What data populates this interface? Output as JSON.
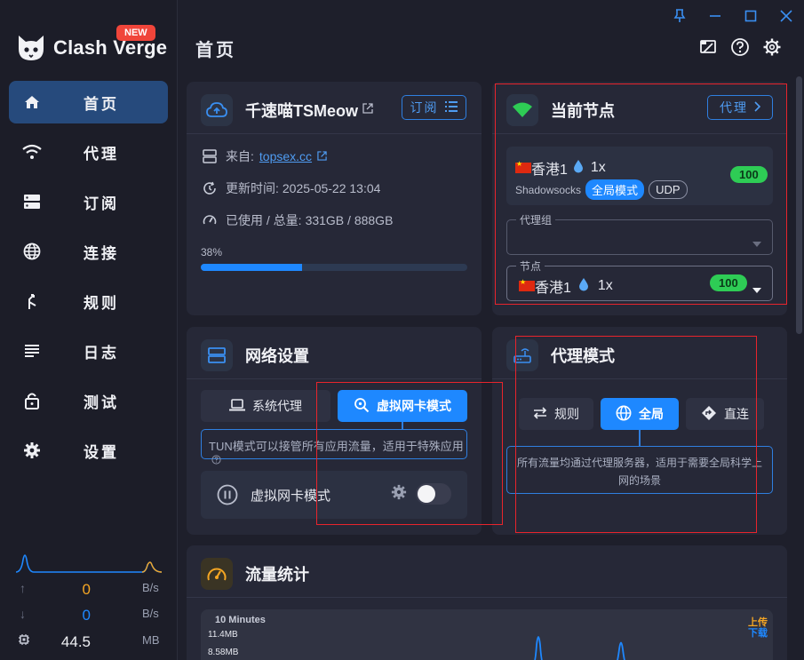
{
  "app": {
    "name": "Clash Verge",
    "badge": "NEW"
  },
  "page_title": "首页",
  "sidebar": {
    "items": [
      {
        "label": "首页",
        "icon": "home-icon",
        "active": true
      },
      {
        "label": "代理",
        "icon": "wifi-icon"
      },
      {
        "label": "订阅",
        "icon": "storage-icon"
      },
      {
        "label": "连接",
        "icon": "globe-icon"
      },
      {
        "label": "规则",
        "icon": "fork-icon"
      },
      {
        "label": "日志",
        "icon": "list-icon"
      },
      {
        "label": "测试",
        "icon": "lock-icon"
      },
      {
        "label": "设置",
        "icon": "gear-icon"
      }
    ],
    "traffic": {
      "upload": "0",
      "upload_unit": "B/s",
      "download": "0",
      "download_unit": "B/s",
      "memory": "44.5",
      "memory_unit": "MB"
    }
  },
  "profile": {
    "name": "千速喵TSMeow",
    "button": "订阅",
    "source_label": "来自:",
    "source": "topsex.cc",
    "update_label": "更新时间:",
    "update_time": "2025-05-22 13:04",
    "usage_label": "已使用 / 总量:",
    "usage": "331GB / 888GB",
    "percent_text": "38%",
    "percent": 0.38
  },
  "current_node": {
    "title": "当前节点",
    "button": "代理",
    "node_name": "香港1",
    "multiplier": "1x",
    "protocol": "Shadowsocks",
    "tag_mode": "全局模式",
    "tag_udp": "UDP",
    "delay": "100",
    "group_label": "代理组",
    "group_value": "",
    "node_label": "节点",
    "node_value": "香港1",
    "node_multiplier": "1x",
    "node_delay": "100"
  },
  "network": {
    "title": "网络设置",
    "tab_system": "系统代理",
    "tab_tun": "虚拟网卡模式",
    "hint": "TUN模式可以接管所有应用流量，适用于特殊应用",
    "row_label": "虚拟网卡模式"
  },
  "proxy_mode": {
    "title": "代理模式",
    "modes": [
      "规则",
      "全局",
      "直连"
    ],
    "active": "全局",
    "description": "所有流量均通过代理服务器，适用于需要全局科学上网的场景"
  },
  "traffic_stats": {
    "title": "流量统计",
    "range": "10 Minutes",
    "legend_up": "上传",
    "legend_down": "下载",
    "y_labels": [
      "11.4MB",
      "8.58MB"
    ]
  },
  "colors": {
    "accent": "#1e88ff",
    "upload": "#f5a623",
    "download": "#1e88ff",
    "highlight": "#e8242c"
  }
}
